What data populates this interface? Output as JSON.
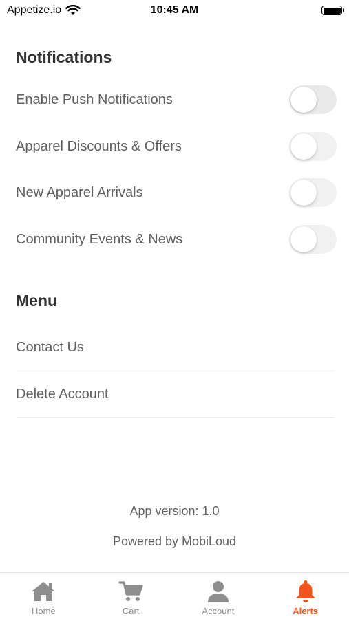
{
  "status_bar": {
    "carrier": "Appetize.io",
    "time": "10:45 AM",
    "icons": [
      "wifi-icon",
      "battery-icon"
    ]
  },
  "notifications": {
    "title": "Notifications",
    "items": [
      {
        "label": "Enable Push Notifications",
        "enabled": false
      },
      {
        "label": "Apparel Discounts & Offers",
        "enabled": false
      },
      {
        "label": "New Apparel Arrivals",
        "enabled": false
      },
      {
        "label": "Community Events & News",
        "enabled": false
      }
    ]
  },
  "menu": {
    "title": "Menu",
    "items": [
      {
        "label": "Contact Us"
      },
      {
        "label": "Delete Account"
      }
    ]
  },
  "footer": {
    "version": "App version: 1.0",
    "powered_by": "Powered by MobiLoud"
  },
  "tab_bar": {
    "active_color": "#f2541b",
    "inactive_color": "#8e8e8e",
    "tabs": [
      {
        "label": "Home",
        "icon": "home-icon",
        "active": false
      },
      {
        "label": "Cart",
        "icon": "cart-icon",
        "active": false
      },
      {
        "label": "Account",
        "icon": "account-icon",
        "active": false
      },
      {
        "label": "Alerts",
        "icon": "bell-icon",
        "active": true
      }
    ]
  }
}
